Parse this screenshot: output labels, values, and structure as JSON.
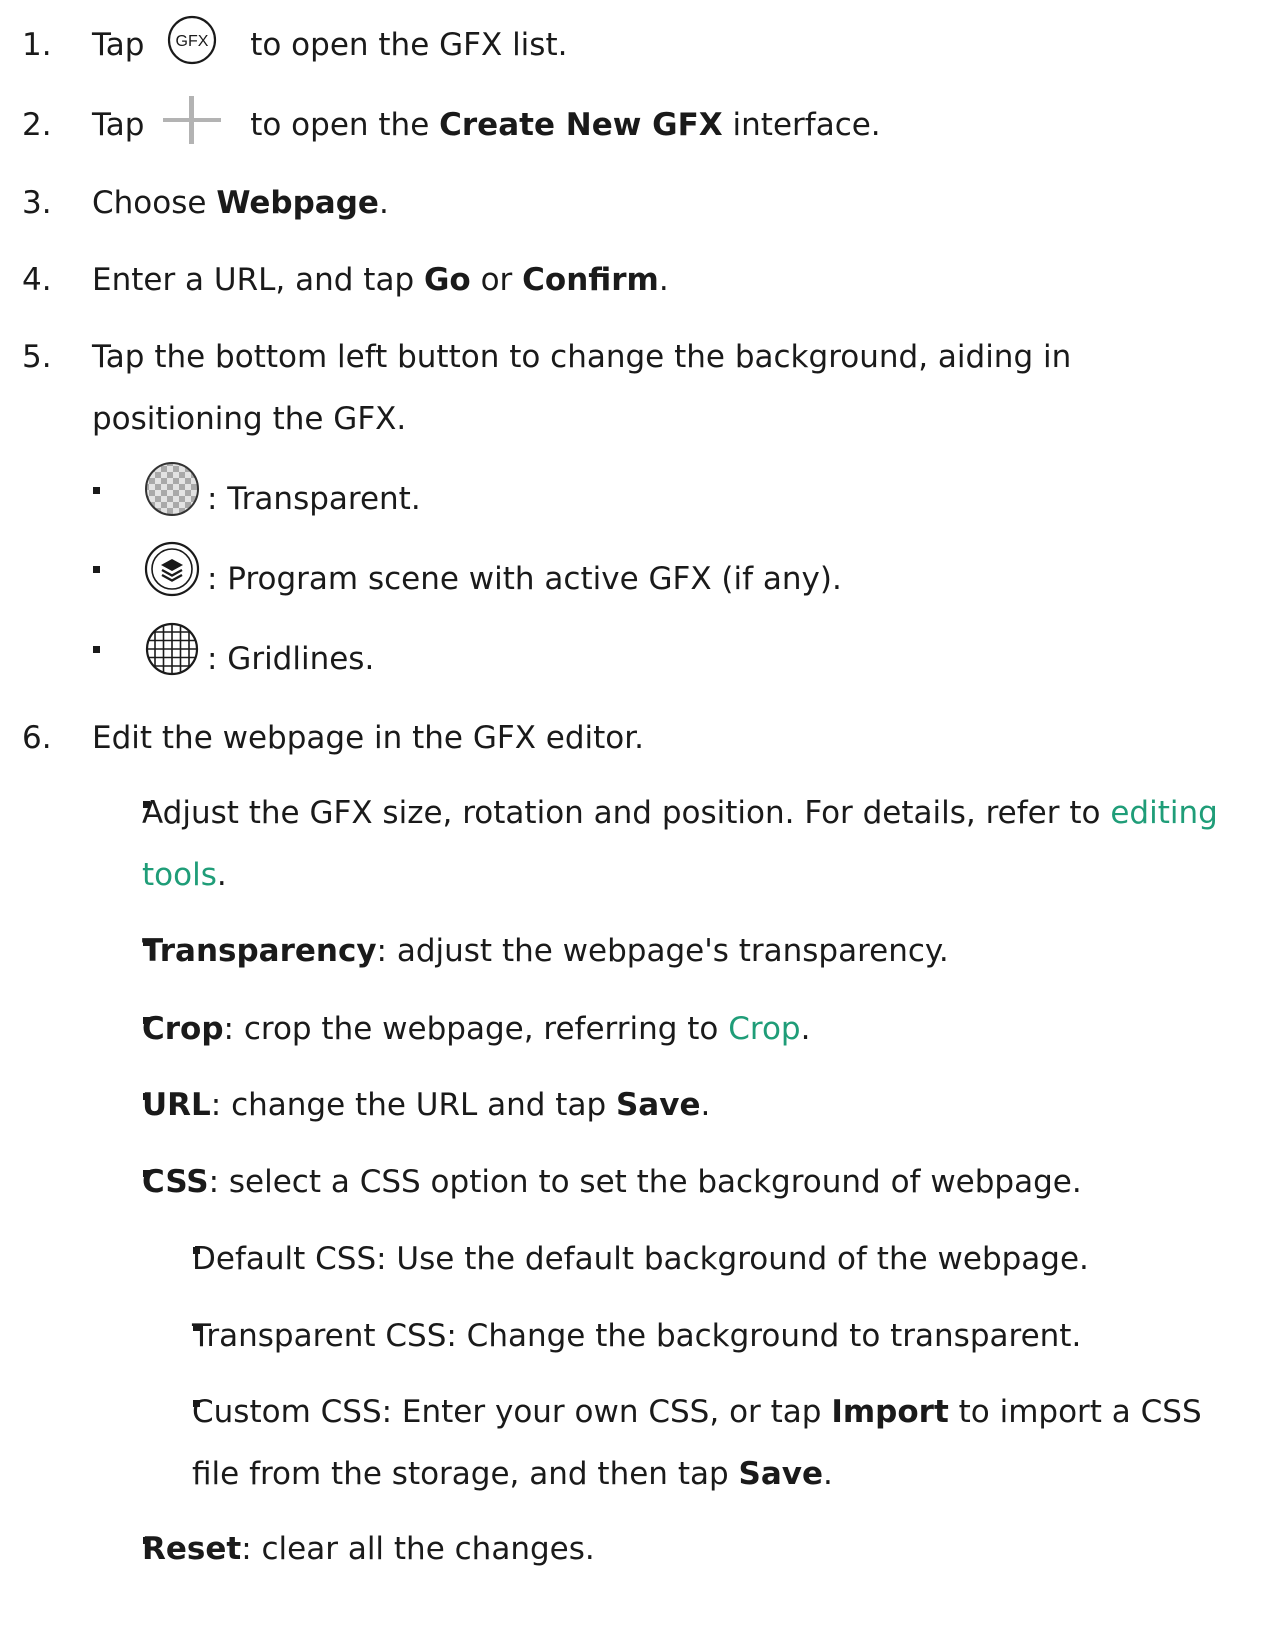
{
  "steps": [
    {
      "number": "1.",
      "pre": "Tap",
      "post": "to open the GFX list.",
      "icon": "gfx-icon",
      "icon_text": "GFX"
    },
    {
      "number": "2.",
      "pre": "Tap",
      "post": "to open the",
      "bold": "Create New GFX",
      "after": "interface.",
      "icon": "plus-icon"
    },
    {
      "number": "3.",
      "pre": "Choose",
      "bold": "Webpage",
      "after": "."
    },
    {
      "number": "4.",
      "pre": "Enter a URL, and tap",
      "bold1": "Go",
      "mid": "or",
      "bold2": "Confirm",
      "after": "."
    },
    {
      "number": "5.",
      "line1": "Tap the bottom left button to change the background, aiding in",
      "line2": "positioning the GFX.",
      "options": [
        {
          "icon": "transparent-checker-icon",
          "text": ": Transparent."
        },
        {
          "icon": "layers-icon",
          "text": ": Program scene with active GFX (if any)."
        },
        {
          "icon": "grid-icon",
          "text": ": Gridlines."
        }
      ]
    },
    {
      "number": "6.",
      "text": "Edit the webpage in the GFX editor.",
      "items": {
        "adjust": {
          "line1": "Adjust the GFX size, rotation and position. For details, refer to",
          "link1": "editing",
          "link2": "tools",
          "after": "."
        },
        "transparency": {
          "bold": "Transparency",
          "text": ": adjust the webpage's transparency."
        },
        "crop": {
          "bold": "Crop",
          "text": ": crop the webpage, referring to",
          "link": "Crop",
          "after": "."
        },
        "url": {
          "bold": "URL",
          "text": ": change the URL and tap",
          "bold2": "Save",
          "after": "."
        },
        "css": {
          "bold": "CSS",
          "text": ": select a CSS option to set the background of webpage.",
          "sub": {
            "default": "Default CSS: Use the default background of the webpage.",
            "transparent": "Transparent CSS: Change the background to transparent.",
            "custom": {
              "pre": "Custom CSS: Enter your own CSS, or tap",
              "bold": "Import",
              "post": "to import a CSS",
              "line2": "file from the storage, and then tap",
              "bold2": "Save",
              "after": "."
            }
          }
        },
        "reset": {
          "bold": "Reset",
          "text": ": clear all the changes."
        }
      }
    }
  ],
  "colors": {
    "text": "#1a1a1a",
    "link": "#1f9d78",
    "icon_gray": "#b3b3b3"
  }
}
